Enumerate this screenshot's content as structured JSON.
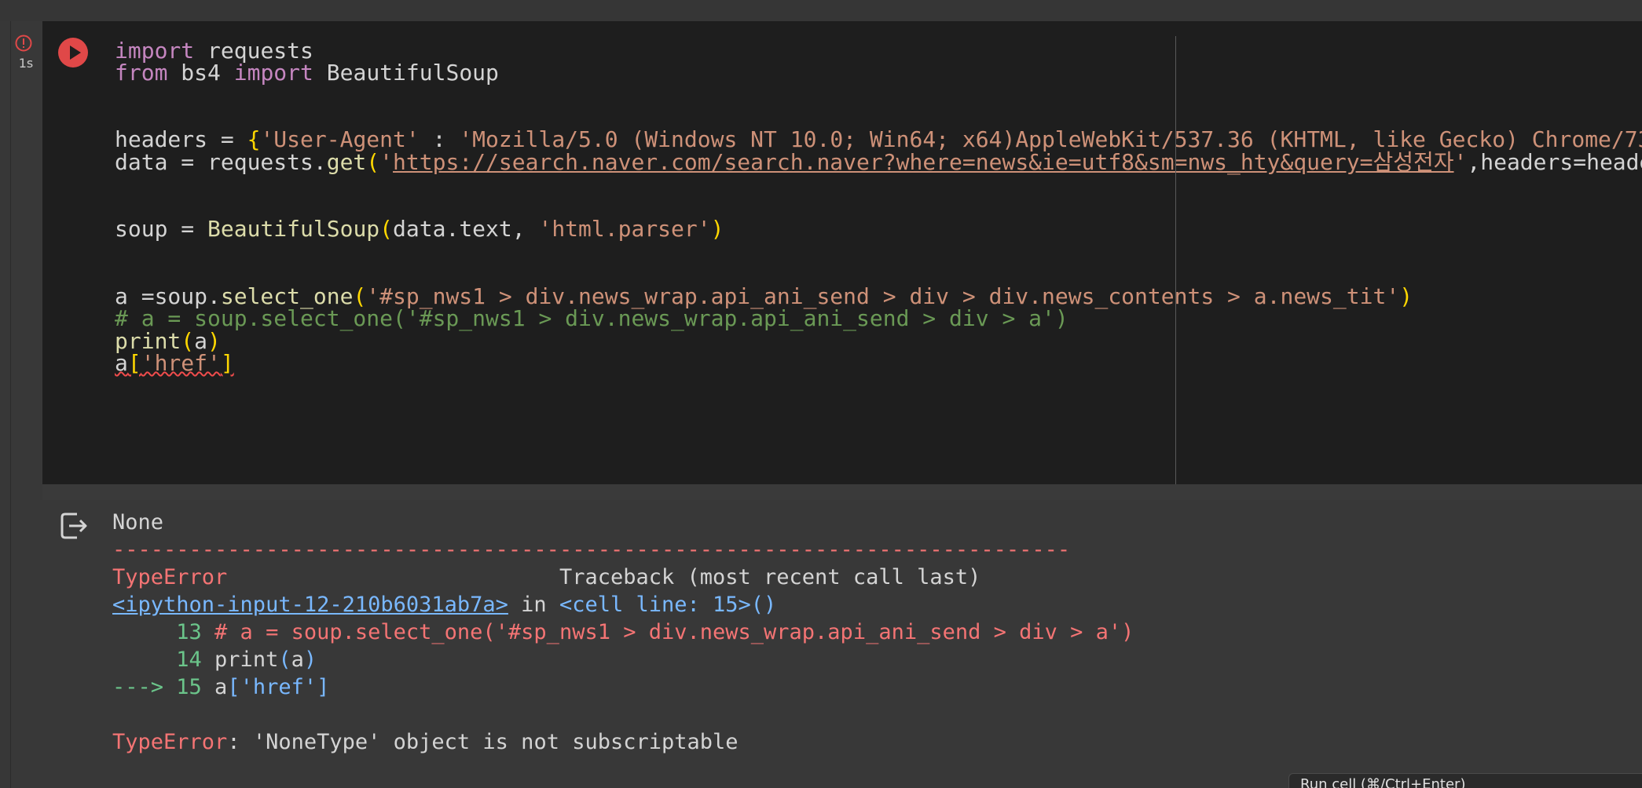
{
  "gutter": {
    "exec_time": "1s",
    "error_icon": "error-circle-icon",
    "run_icon": "play-icon"
  },
  "code": {
    "l1": {
      "kw1": "import",
      "rest": " requests"
    },
    "l2": {
      "kw1": "from",
      "mid": " bs4 ",
      "kw2": "import",
      "rest": " BeautifulSoup"
    },
    "l3": {
      "a": "headers = ",
      "b": "{",
      "c": "'User-Agent'",
      "d": " : ",
      "e": "'Mozilla/5.0 (Windows NT 10.0; Win64; x64)AppleWebKit/537.36 (KHTML, like Gecko) Chrome/73"
    },
    "l4": {
      "a": "data = requests.",
      "fn": "get",
      "b": "(",
      "q1": "'",
      "url": "https://search.naver.com/search.naver?where=news&ie=utf8&sm=nws_hty&query=삼성전자",
      "q2": "'",
      "rest": ",headers=heade"
    },
    "l5": {
      "a": "soup = ",
      "fn": "BeautifulSoup",
      "b": "(",
      "c": "data.text, ",
      "s": "'html.parser'",
      "d": ")"
    },
    "l6": {
      "a": "a =soup.",
      "fn": "select_one",
      "b": "(",
      "s": "'#sp_nws1 > div.news_wrap.api_ani_send > div > div.news_contents > a.news_tit'",
      "d": ")"
    },
    "l7": "# a = soup.select_one('#sp_nws1 > div.news_wrap.api_ani_send > div > a')",
    "l8": {
      "fn": "print",
      "b": "(",
      "c": "a",
      "d": ")"
    },
    "l9": {
      "a": "a",
      "b": "[",
      "s": "'href'",
      "d": "]"
    }
  },
  "output": {
    "icon": "output-redirect-icon",
    "none": "None",
    "dashes": "---------------------------------------------------------------------------",
    "err_name": "TypeError",
    "traceback": "                          Traceback (most recent call last)",
    "link": "<ipython-input-12-210b6031ab7a>",
    "in_text": " in ",
    "cell_line": "<cell line: 15>()",
    "t13_num": "     13 ",
    "t13_text": "# a = soup.select_one('#sp_nws1 > div.news_wrap.api_ani_send > div > a')",
    "t14_num": "     14 ",
    "t14_fn": "print",
    "t14_b": "(",
    "t14_c": "a",
    "t14_d": ")",
    "t15_arrow": "---> 15 ",
    "t15_a": "a",
    "t15_b": "[",
    "t15_s": "'href'",
    "t15_d": "]",
    "final_name": "TypeError",
    "final_msg": ": 'NoneType' object is not subscriptable"
  },
  "status": {
    "text": "Run cell (⌘/Ctrl+Enter)"
  }
}
